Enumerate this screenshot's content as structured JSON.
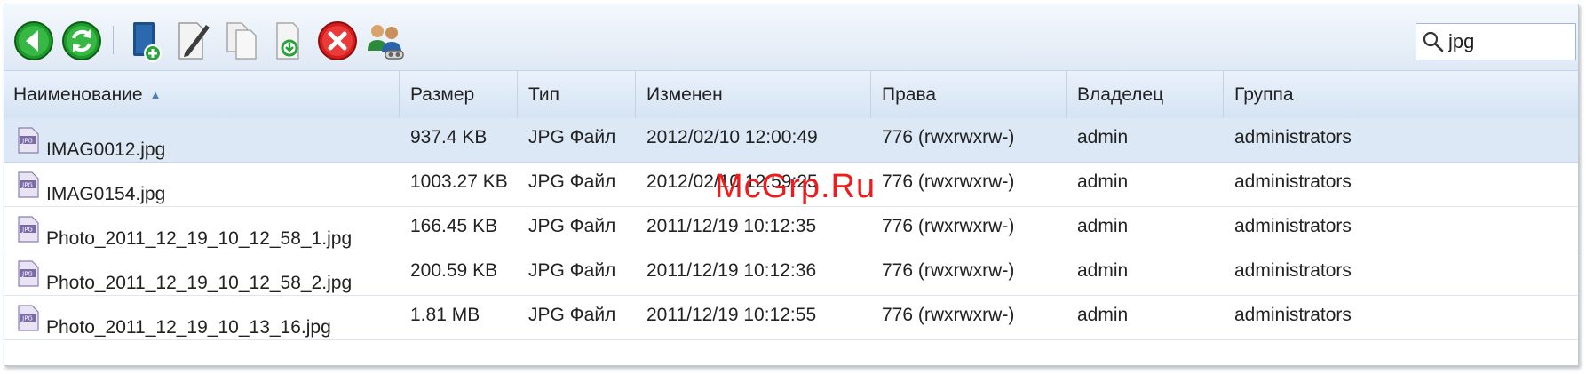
{
  "toolbar": {
    "buttons": [
      {
        "name": "back-button",
        "icon": "back-arrow-icon"
      },
      {
        "name": "refresh-button",
        "icon": "refresh-icon"
      },
      {
        "name": "new-folder-button",
        "icon": "new-folder-icon"
      },
      {
        "name": "rename-button",
        "icon": "edit-icon"
      },
      {
        "name": "copy-button",
        "icon": "copy-icon"
      },
      {
        "name": "paste-button",
        "icon": "paste-icon"
      },
      {
        "name": "delete-button",
        "icon": "delete-icon"
      },
      {
        "name": "permissions-button",
        "icon": "users-icon"
      }
    ],
    "search_value": "jpg"
  },
  "table": {
    "columns": [
      "Наименование",
      "Размер",
      "Тип",
      "Изменен",
      "Права",
      "Владелец",
      "Группа"
    ],
    "rows": [
      {
        "name": "IMAG0012.jpg",
        "size": "937.4 KB",
        "type": "JPG Файл",
        "modified": "2012/02/10 12:00:49",
        "perms": "776 (rwxrwxrw-)",
        "owner": "admin",
        "group": "administrators",
        "selected": true
      },
      {
        "name": "IMAG0154.jpg",
        "size": "1003.27 KB",
        "type": "JPG Файл",
        "modified": "2012/02/10 12:59:25",
        "perms": "776 (rwxrwxrw-)",
        "owner": "admin",
        "group": "administrators",
        "selected": false
      },
      {
        "name": "Photo_2011_12_19_10_12_58_1.jpg",
        "size": "166.45 KB",
        "type": "JPG Файл",
        "modified": "2011/12/19 10:12:35",
        "perms": "776 (rwxrwxrw-)",
        "owner": "admin",
        "group": "administrators",
        "selected": false
      },
      {
        "name": "Photo_2011_12_19_10_12_58_2.jpg",
        "size": "200.59 KB",
        "type": "JPG Файл",
        "modified": "2011/12/19 10:12:36",
        "perms": "776 (rwxrwxrw-)",
        "owner": "admin",
        "group": "administrators",
        "selected": false
      },
      {
        "name": "Photo_2011_12_19_10_13_16.jpg",
        "size": "1.81 MB",
        "type": "JPG Файл",
        "modified": "2011/12/19 10:12:55",
        "perms": "776 (rwxrwxrw-)",
        "owner": "admin",
        "group": "administrators",
        "selected": false
      }
    ]
  },
  "file_icon_label": "JPG",
  "watermark": "McGrp.Ru"
}
